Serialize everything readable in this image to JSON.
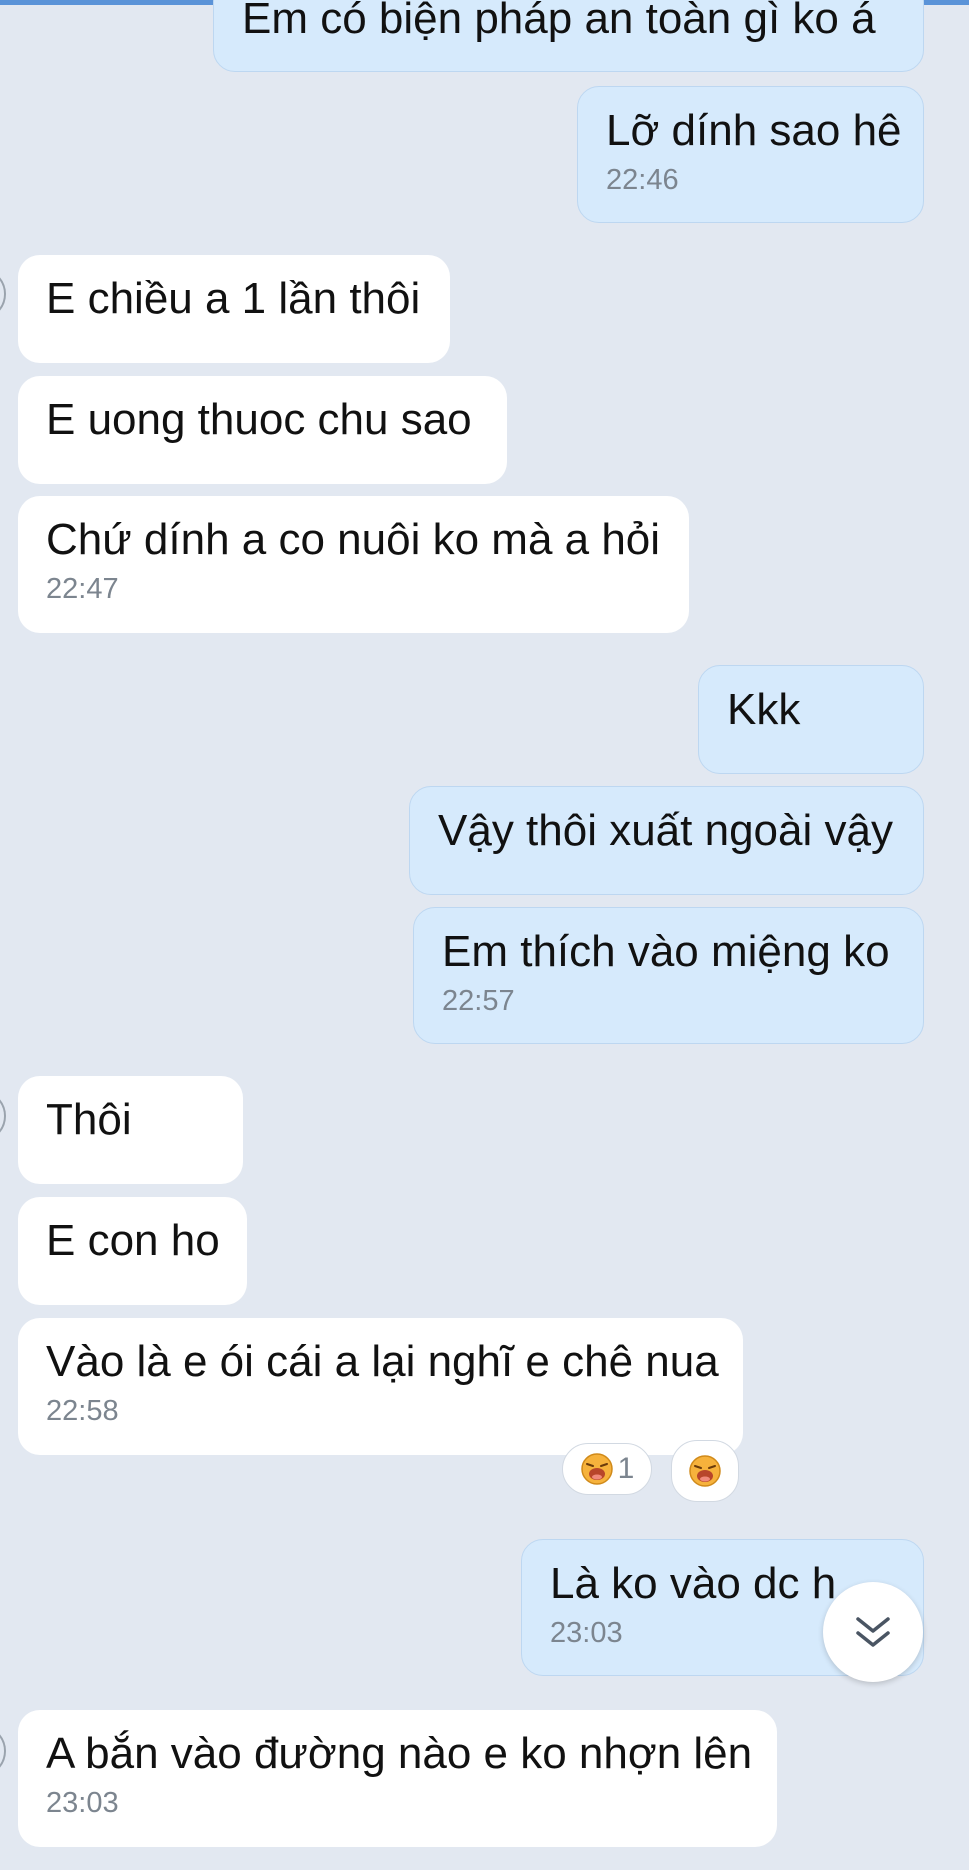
{
  "messages": [
    {
      "text": "Em có biện pháp an toàn gì ko á",
      "time": "",
      "side": "mine"
    },
    {
      "text": "Lỡ dính sao hê",
      "time": "22:46",
      "side": "mine"
    },
    {
      "text": "E chiều a 1 lần thôi",
      "time": "",
      "side": "theirs"
    },
    {
      "text": "E uong thuoc chu sao",
      "time": "",
      "side": "theirs"
    },
    {
      "text": "Chứ dính a co nuôi ko mà a hỏi",
      "time": "22:47",
      "side": "theirs"
    },
    {
      "text": "Kkk",
      "time": "",
      "side": "mine"
    },
    {
      "text": "Vậy thôi xuất ngoài vậy",
      "time": "",
      "side": "mine"
    },
    {
      "text": "Em thích vào miệng ko",
      "time": "22:57",
      "side": "mine"
    },
    {
      "text": "Thôi",
      "time": "",
      "side": "theirs"
    },
    {
      "text": "E con ho",
      "time": "",
      "side": "theirs"
    },
    {
      "text": "Vào là e ói cái a lại nghĩ e chê nua",
      "time": "22:58",
      "side": "theirs"
    },
    {
      "text": "Là ko vào dc h",
      "time": "23:03",
      "side": "mine"
    },
    {
      "text": "A bắn vào đường nào e ko nhợn lên",
      "time": "23:03",
      "side": "theirs"
    }
  ],
  "reaction": {
    "emoji": "laughing-emoji",
    "count": "1"
  },
  "colors": {
    "background": "#e2e8f1",
    "mine_bubble": "#d6eafc",
    "theirs_bubble": "#ffffff",
    "timestamp": "#7c858f"
  },
  "icons": {
    "scroll_down": "double-chevron-down-icon"
  }
}
